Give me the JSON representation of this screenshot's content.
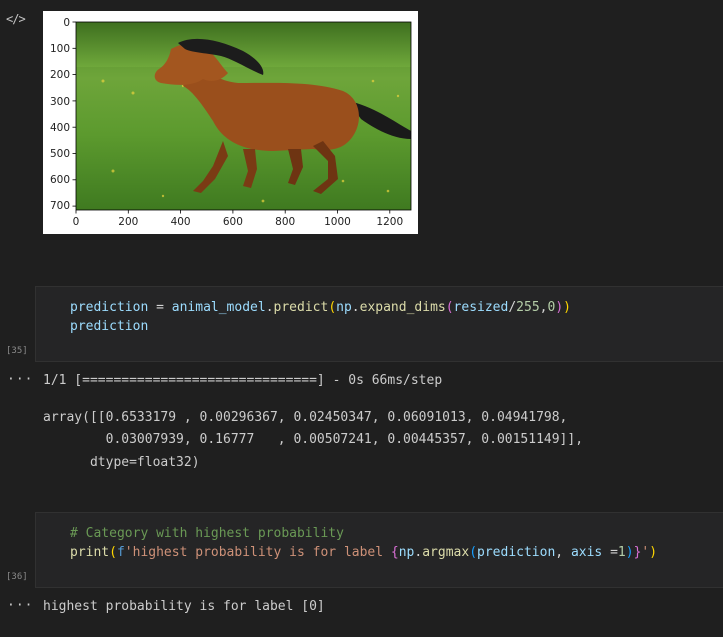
{
  "output_plot": {
    "x_ticks": [
      "0",
      "200",
      "400",
      "600",
      "800",
      "1000",
      "1200"
    ],
    "y_ticks": [
      "0",
      "100",
      "200",
      "300",
      "400",
      "500",
      "600",
      "700"
    ],
    "image_subject": "running bay horse on grass field"
  },
  "cell_35": {
    "exec_count": "[35]",
    "line1": {
      "var": "prediction",
      "eq": " = ",
      "obj": "animal_model",
      "dot1": ".",
      "fn": "predict",
      "p1": "(",
      "np": "np",
      "dot2": ".",
      "fn2": "expand_dims",
      "p2": "(",
      "arg": "resized",
      "slash": "/",
      "n255": "255",
      "comma": ",",
      "n0": "0",
      "p2c": ")",
      "p1c": ")"
    },
    "line2": "prediction",
    "output_dots": "···",
    "progress_line": "1/1 [==============================] - 0s 66ms/step",
    "array_line1": "array([[0.6533179 , 0.00296367, 0.02450347, 0.06091013, 0.04941798,",
    "array_line2": "        0.03007939, 0.16777   , 0.00507241, 0.00445357, 0.00151149]],",
    "array_line3": "      dtype=float32)"
  },
  "cell_36": {
    "exec_count": "[36]",
    "comment": "# Category with highest probability",
    "line2": {
      "fn": "print",
      "p1": "(",
      "fprefix": "f",
      "str1": "'highest probability is for label ",
      "b1": "{",
      "np": "np",
      "dot": ".",
      "fn2": "argmax",
      "p2": "(",
      "arg": "prediction",
      "comma": ", ",
      "kw": "axis",
      "eq": " =",
      "n1": "1",
      "p2c": ")",
      "b1c": "}",
      "str2": "'",
      "p1c": ")"
    },
    "output_dots": "···",
    "output_text": "highest probability is for label [0]"
  },
  "colors": {
    "background": "#1f1f1f",
    "cell_bg": "#252526",
    "variable": "#9cdcfe",
    "function": "#dcdcaa",
    "number": "#b5cea8",
    "string": "#ce9178",
    "comment": "#6a9955"
  }
}
